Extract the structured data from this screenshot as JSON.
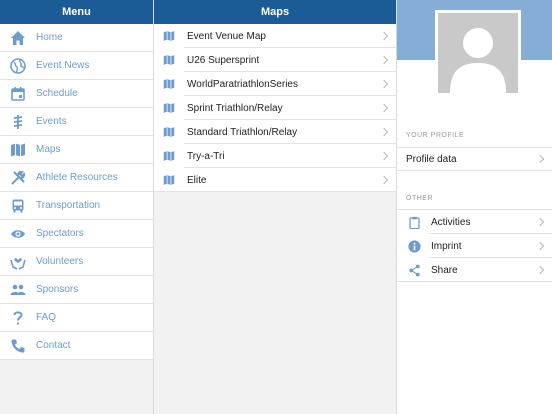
{
  "menu": {
    "title": "Menu",
    "items": [
      {
        "label": "Home",
        "icon": "home-icon"
      },
      {
        "label": "Event News",
        "icon": "globe-icon"
      },
      {
        "label": "Schedule",
        "icon": "calendar-icon"
      },
      {
        "label": "Events",
        "icon": "events-icon"
      },
      {
        "label": "Maps",
        "icon": "map-icon"
      },
      {
        "label": "Athlete Resources",
        "icon": "tools-icon"
      },
      {
        "label": "Transportation",
        "icon": "bus-icon"
      },
      {
        "label": "Spectators",
        "icon": "eye-icon"
      },
      {
        "label": "Volunteers",
        "icon": "volunteer-hands-icon"
      },
      {
        "label": "Sponsors",
        "icon": "people-icon"
      },
      {
        "label": "FAQ",
        "icon": "question-icon"
      },
      {
        "label": "Contact",
        "icon": "phone-icon"
      }
    ]
  },
  "maps": {
    "title": "Maps",
    "items": [
      {
        "label": "Event Venue Map"
      },
      {
        "label": "U26 Supersprint"
      },
      {
        "label": "WorldParatriathlonSeries"
      },
      {
        "label": "Sprint Triathlon/Relay"
      },
      {
        "label": "Standard Triathlon/Relay"
      },
      {
        "label": "Try-a-Tri"
      },
      {
        "label": "Elite"
      }
    ]
  },
  "profile": {
    "section_your_profile": "YOUR PROFILE",
    "profile_data": "Profile data",
    "section_other": "OTHER",
    "other_items": [
      {
        "label": "Activities",
        "icon": "clipboard-icon"
      },
      {
        "label": "Imprint",
        "icon": "info-icon"
      },
      {
        "label": "Share",
        "icon": "share-icon"
      }
    ]
  },
  "colors": {
    "header": "#1b5b96",
    "accent": "#6f9ccb",
    "profile_banner": "#86add6"
  }
}
